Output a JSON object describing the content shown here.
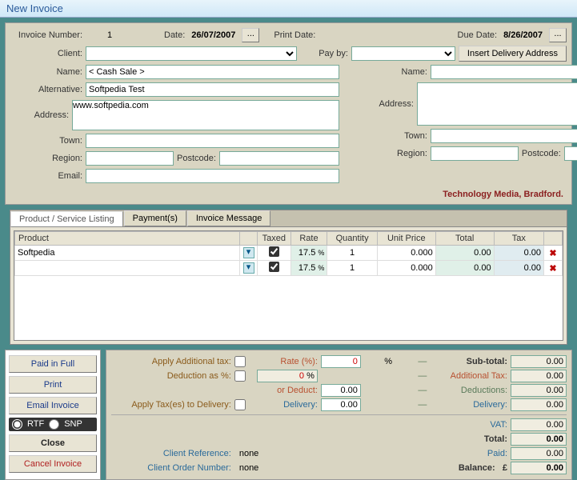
{
  "window": {
    "title": "New Invoice"
  },
  "header": {
    "invoice_number_label": "Invoice Number:",
    "invoice_number": "1",
    "date_label": "Date:",
    "date": "26/07/2007",
    "print_date_label": "Print Date:",
    "print_date": "",
    "due_date_label": "Due Date:",
    "due_date": "8/26/2007"
  },
  "client_row": {
    "client_label": "Client:",
    "client": "",
    "pay_by_label": "Pay by:",
    "pay_by": "",
    "insert_btn": "Insert Delivery Address"
  },
  "left": {
    "name_label": "Name:",
    "name": "< Cash Sale >",
    "alt_label": "Alternative:",
    "alt": "Softpedia Test",
    "address_label": "Address:",
    "address": "www.softpedia.com",
    "town_label": "Town:",
    "town": "",
    "region_label": "Region:",
    "region": "",
    "postcode_label": "Postcode:",
    "postcode": "",
    "email_label": "Email:",
    "email": ""
  },
  "right": {
    "name_label": "Name:",
    "name": "",
    "address_label": "Address:",
    "address": "",
    "town_label": "Town:",
    "town": "",
    "region_label": "Region:",
    "region": "",
    "postcode_label": "Postcode:",
    "postcode": ""
  },
  "footer_company": "Technology Media, Bradford.",
  "tabs": {
    "listing": "Product / Service Listing",
    "payments": "Payment(s)",
    "message": "Invoice Message"
  },
  "grid": {
    "headers": {
      "product": "Product",
      "taxed": "Taxed",
      "rate": "Rate",
      "qty": "Quantity",
      "unit": "Unit Price",
      "total": "Total",
      "tax": "Tax"
    },
    "rows": [
      {
        "product": "Softpedia",
        "taxed": true,
        "rate": "17.5",
        "pct": "%",
        "qty": "1",
        "unit": "0.000",
        "total": "0.00",
        "tax": "0.00"
      },
      {
        "product": "",
        "taxed": true,
        "rate": "17.5",
        "pct": "%",
        "qty": "1",
        "unit": "0.000",
        "total": "0.00",
        "tax": "0.00"
      }
    ]
  },
  "buttons": {
    "paid_full": "Paid in Full",
    "print": "Print",
    "email": "Email Invoice",
    "rtf": "RTF",
    "snp": "SNP",
    "close": "Close",
    "cancel": "Cancel  Invoice"
  },
  "totals": {
    "apply_add_tax": "Apply Additional tax:",
    "rate_pct": "Rate (%):",
    "rate_val": "0",
    "pct": "%",
    "deduction_as_pct": "Deduction as %:",
    "deduct_val": "0",
    "or_deduct": "or Deduct:",
    "or_deduct_val": "0.00",
    "apply_tax_delivery": "Apply Tax(es) to Delivery:",
    "delivery_label": "Delivery:",
    "delivery_val": "0.00",
    "subtotal_label": "Sub-total:",
    "subtotal": "0.00",
    "add_tax_label": "Additional Tax:",
    "add_tax": "0.00",
    "deductions_label": "Deductions:",
    "deductions": "0.00",
    "delivery2_label": "Delivery:",
    "delivery2": "0.00",
    "vat_label": "VAT:",
    "vat": "0.00",
    "total_label": "Total:",
    "total": "0.00",
    "paid_label": "Paid:",
    "paid": "0.00",
    "balance_label": "Balance:",
    "currency": "£",
    "balance": "0.00",
    "client_ref_label": "Client Reference:",
    "client_ref": "none",
    "client_order_label": "Client Order Number:",
    "client_order": "none",
    "dash": "—"
  }
}
